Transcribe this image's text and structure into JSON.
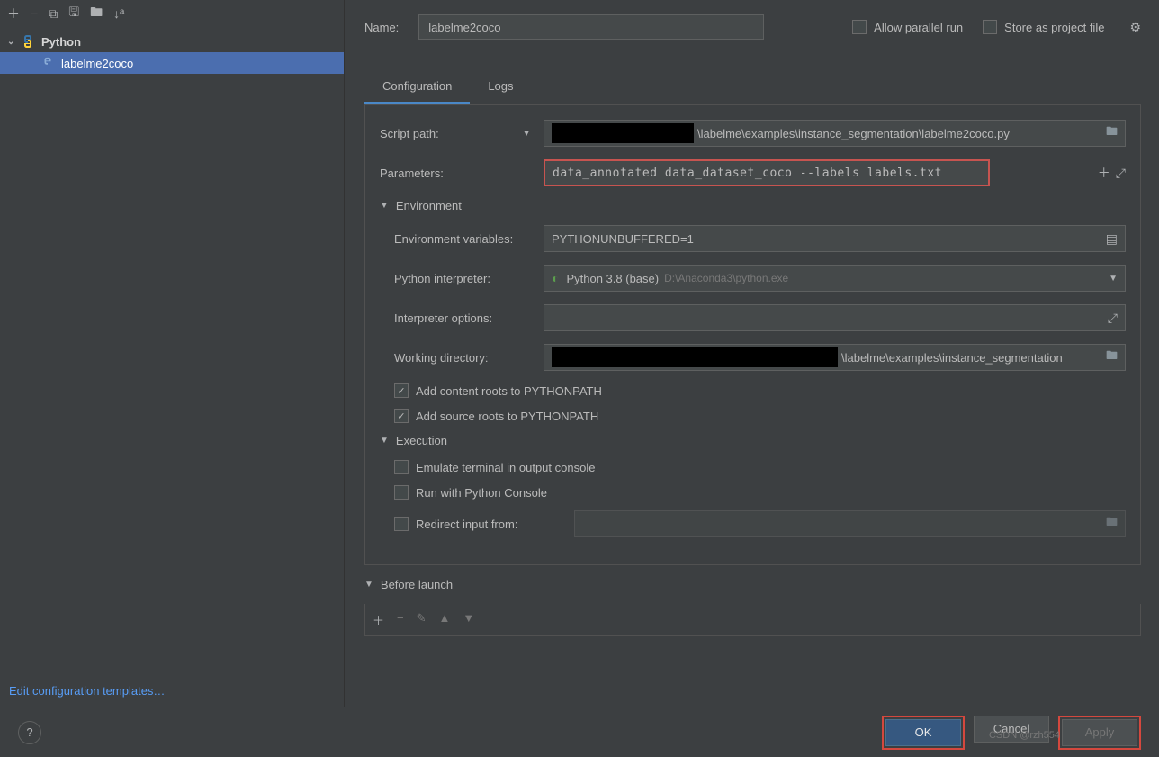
{
  "sidebar": {
    "group": "Python",
    "item": "labelme2coco",
    "editLink": "Edit configuration templates…"
  },
  "header": {
    "nameLabel": "Name:",
    "nameValue": "labelme2coco",
    "allowParallel": "Allow parallel run",
    "storeProject": "Store as project file"
  },
  "tabs": {
    "config": "Configuration",
    "logs": "Logs"
  },
  "form": {
    "scriptPathLabel": "Script path:",
    "scriptPathValue": "\\labelme\\examples\\instance_segmentation\\labelme2coco.py",
    "parametersLabel": "Parameters:",
    "parametersValue": "data_annotated data_dataset_coco --labels labels.txt",
    "envSection": "Environment",
    "envVarsLabel": "Environment variables:",
    "envVarsValue": "PYTHONUNBUFFERED=1",
    "interpreterLabel": "Python interpreter:",
    "interpreterName": "Python 3.8 (base)",
    "interpreterPath": "D:\\Anaconda3\\python.exe",
    "interpreterOptsLabel": "Interpreter options:",
    "workingDirLabel": "Working directory:",
    "workingDirValue": "\\labelme\\examples\\instance_segmentation",
    "addContentRoots": "Add content roots to PYTHONPATH",
    "addSourceRoots": "Add source roots to PYTHONPATH",
    "execSection": "Execution",
    "emulateTerminal": "Emulate terminal in output console",
    "runPythonConsole": "Run with Python Console",
    "redirectInput": "Redirect input from:",
    "beforeLaunch": "Before launch"
  },
  "footer": {
    "ok": "OK",
    "cancel": "Cancel",
    "apply": "Apply"
  },
  "watermark": "CSDN @rzh554"
}
